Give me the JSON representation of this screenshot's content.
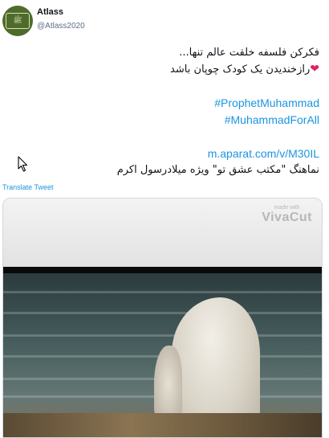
{
  "author": {
    "display_name": "Atlass",
    "handle": "@Atlass2020"
  },
  "tweet": {
    "line1": "فکرکن فلسفه خلقت عالم تنها...",
    "line2": "رازخندیدن یک کودک چوپان باشد",
    "hashtag1": "#ProphetMuhammad",
    "hashtag2": "#MuhammadForAll",
    "link": "m.aparat.com/v/M30IL",
    "line3": "نماهنگ \"مکتب عشق تو\" ویژه میلادرسول اکرم",
    "heart_icon": "red-heart-emoji"
  },
  "translate_label": "Translate Tweet",
  "media": {
    "watermark_small": "made with",
    "watermark_big": "VivaCut"
  },
  "colors": {
    "link": "#1b95e0",
    "handle": "#5b7083",
    "heart": "#e0245e"
  }
}
